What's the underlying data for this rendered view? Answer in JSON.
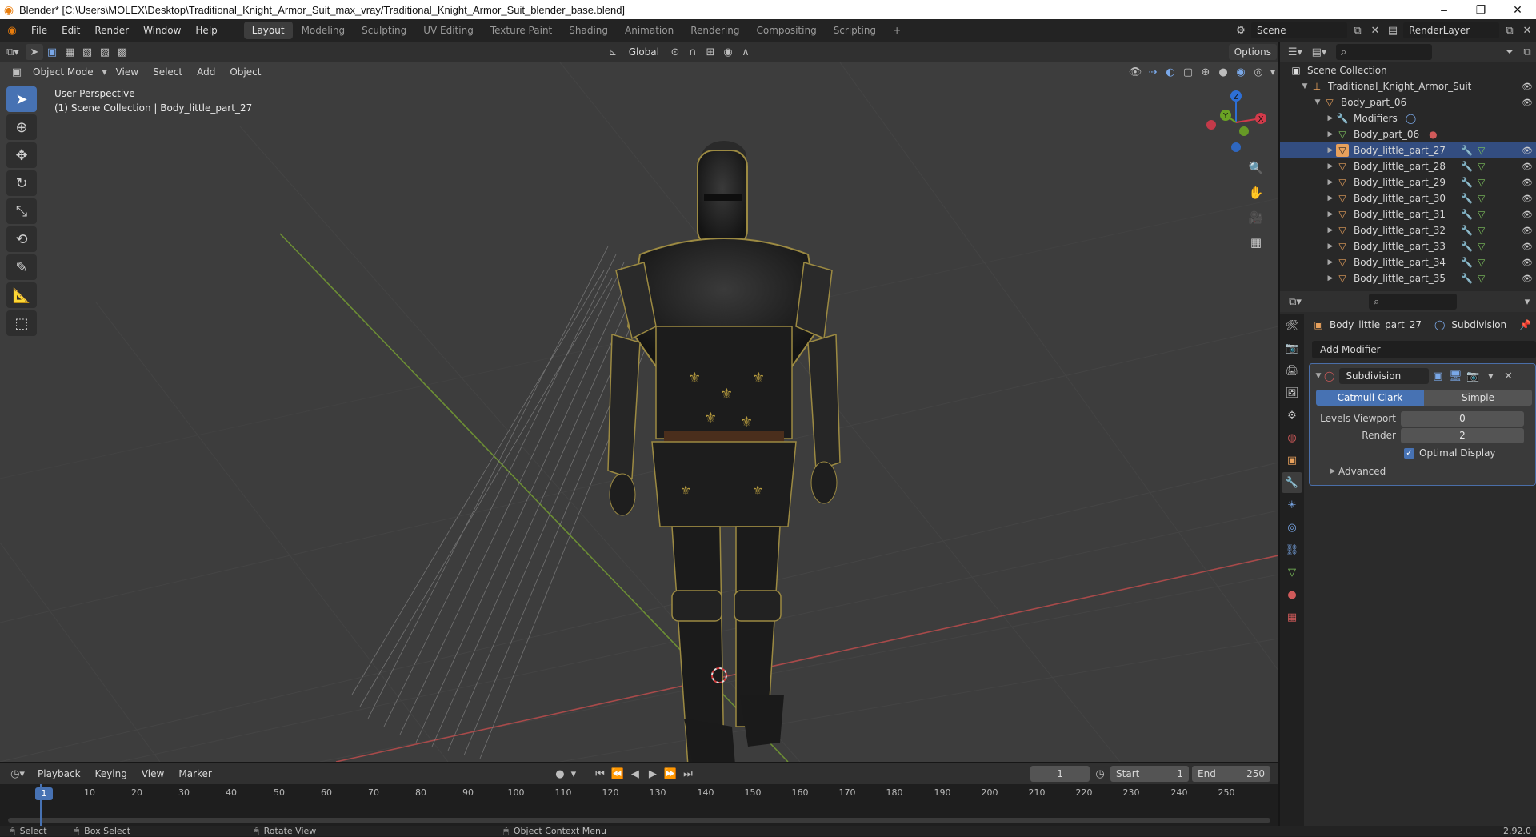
{
  "window": {
    "title": "Blender* [C:\\Users\\MOLEX\\Desktop\\Traditional_Knight_Armor_Suit_max_vray/Traditional_Knight_Armor_Suit_blender_base.blend]",
    "minimize": "–",
    "maximize": "❐",
    "close": "✕"
  },
  "menubar": {
    "items": [
      "File",
      "Edit",
      "Render",
      "Window",
      "Help"
    ]
  },
  "workspaces": [
    "Layout",
    "Modeling",
    "Sculpting",
    "UV Editing",
    "Texture Paint",
    "Shading",
    "Animation",
    "Rendering",
    "Compositing",
    "Scripting"
  ],
  "workspace_add": "+",
  "scene": {
    "label": "Scene",
    "renderlayer": "RenderLayer"
  },
  "viewport_header": {
    "transform_orientation": "Global",
    "options": "Options"
  },
  "viewport_header2": {
    "mode": "Object Mode",
    "menus": [
      "View",
      "Select",
      "Add",
      "Object"
    ]
  },
  "viewport": {
    "perspective": "User Perspective",
    "collection_info": "(1) Scene Collection | Body_little_part_27"
  },
  "gizmo": {
    "x": "X",
    "y": "Y",
    "z": "Z"
  },
  "outliner": {
    "root": "Scene Collection",
    "collection": "Traditional_Knight_Armor_Suit",
    "parent": "Body_part_06",
    "modifiers": "Modifiers",
    "mesh": "Body_part_06",
    "children": [
      "Body_little_part_27",
      "Body_little_part_28",
      "Body_little_part_29",
      "Body_little_part_30",
      "Body_little_part_31",
      "Body_little_part_32",
      "Body_little_part_33",
      "Body_little_part_34",
      "Body_little_part_35"
    ]
  },
  "properties": {
    "object": "Body_little_part_27",
    "modifier_crumb": "Subdivision",
    "add_modifier": "Add Modifier",
    "modifier": {
      "name": "Subdivision",
      "mode_a": "Catmull-Clark",
      "mode_b": "Simple",
      "levels_label": "Levels Viewport",
      "levels_value": "0",
      "render_label": "Render",
      "render_value": "2",
      "optimal_display": "Optimal Display",
      "advanced": "Advanced"
    }
  },
  "timeline": {
    "menus": [
      "Playback",
      "Keying",
      "View",
      "Marker"
    ],
    "current_frame": "1",
    "start_label": "Start",
    "start_value": "1",
    "end_label": "End",
    "end_value": "250",
    "ruler": [
      "1",
      "10",
      "20",
      "30",
      "40",
      "50",
      "60",
      "70",
      "80",
      "90",
      "100",
      "110",
      "120",
      "130",
      "140",
      "150",
      "160",
      "170",
      "180",
      "190",
      "200",
      "210",
      "220",
      "230",
      "240",
      "250"
    ]
  },
  "statusbar": {
    "select": "Select",
    "box_select": "Box Select",
    "rotate": "Rotate View",
    "context": "Object Context Menu",
    "version": "2.92.0"
  }
}
